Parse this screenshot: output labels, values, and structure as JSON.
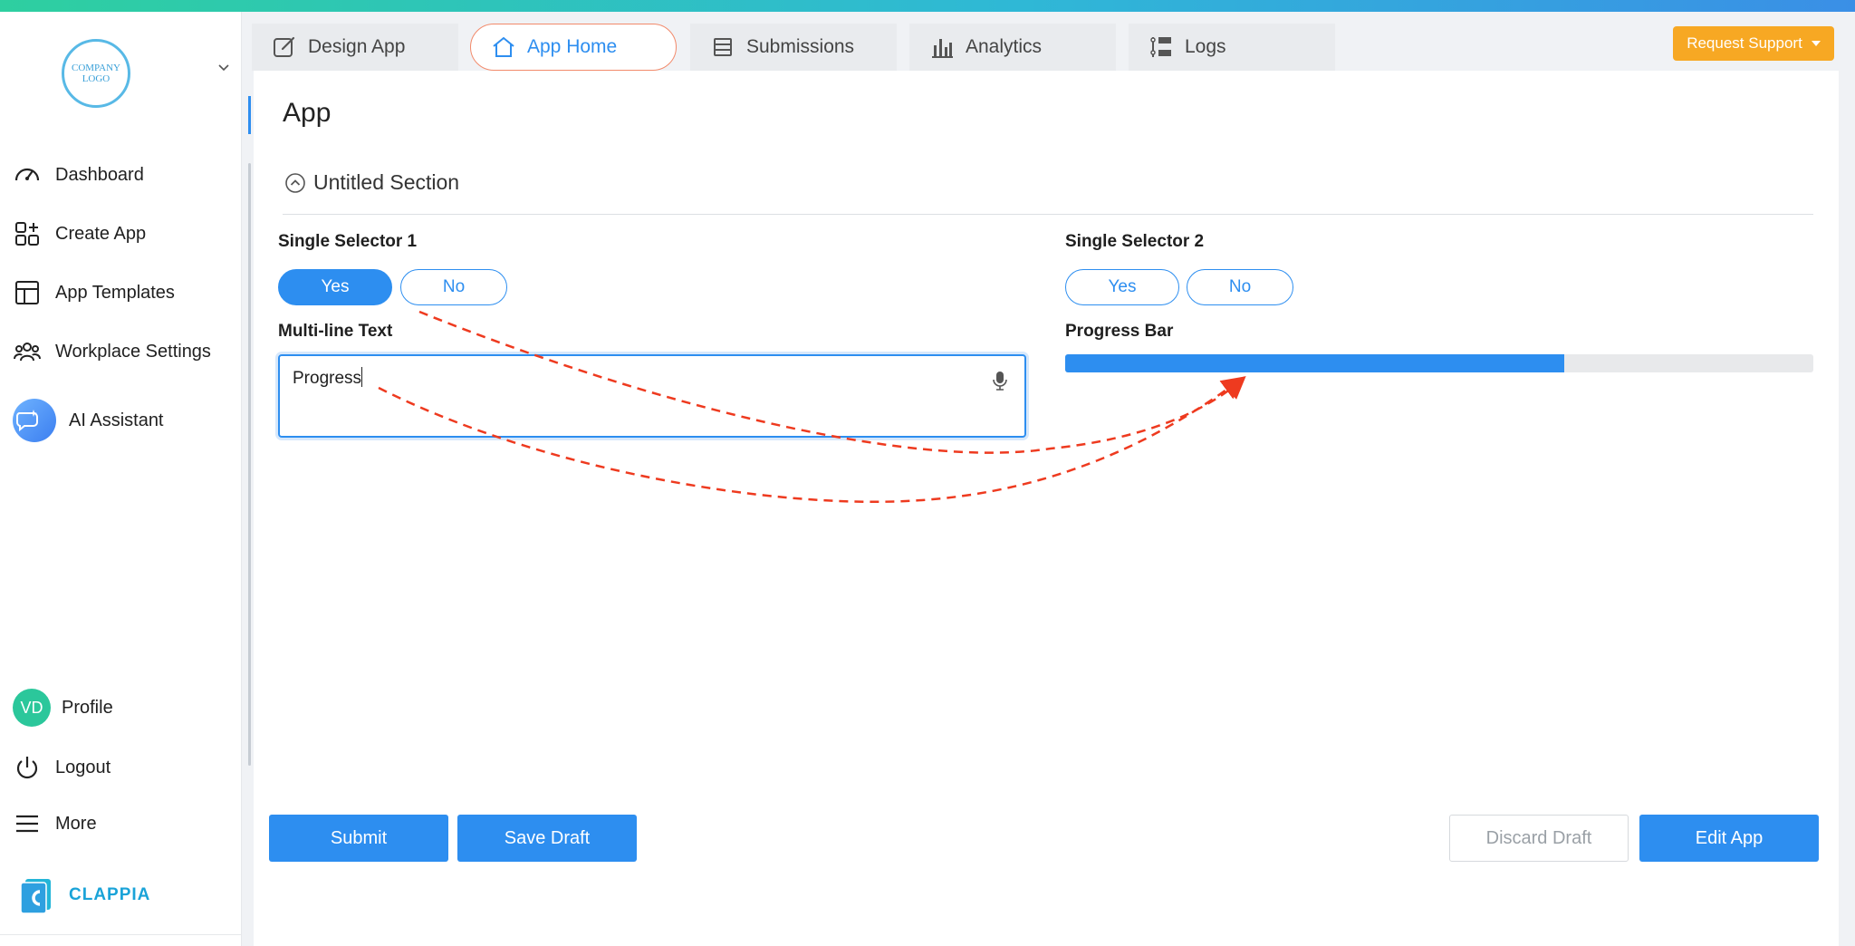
{
  "logo": {
    "text_line1": "COMPANY",
    "text_line2": "LOGO"
  },
  "sidebar": {
    "items": [
      {
        "label": "Dashboard",
        "icon": "speedometer-icon"
      },
      {
        "label": "Create App",
        "icon": "grid-plus-icon"
      },
      {
        "label": "App Templates",
        "icon": "layout-icon"
      },
      {
        "label": "Workplace Settings",
        "icon": "users-icon"
      },
      {
        "label": "AI Assistant",
        "icon": "ai-chat-icon"
      }
    ],
    "profile": {
      "initials": "VD",
      "label": "Profile"
    },
    "logout_label": "Logout",
    "more_label": "More",
    "brand": "CLAPPIA"
  },
  "tabs": [
    {
      "label": "Design App",
      "icon": "edit-icon"
    },
    {
      "label": "App Home",
      "icon": "home-icon",
      "active": true
    },
    {
      "label": "Submissions",
      "icon": "list-icon"
    },
    {
      "label": "Analytics",
      "icon": "bar-chart-icon"
    },
    {
      "label": "Logs",
      "icon": "logs-icon"
    }
  ],
  "support_button": "Request Support",
  "page": {
    "title": "App",
    "section_title": "Untitled Section",
    "selector1": {
      "label": "Single Selector 1",
      "options": [
        "Yes",
        "No"
      ],
      "selected": "Yes"
    },
    "selector2": {
      "label": "Single Selector 2",
      "options": [
        "Yes",
        "No"
      ],
      "selected": ""
    },
    "multiline": {
      "label": "Multi-line Text",
      "value": "Progress"
    },
    "progress": {
      "label": "Progress Bar",
      "fraction": 0.667
    }
  },
  "buttons": {
    "submit": "Submit",
    "save_draft": "Save Draft",
    "discard_draft": "Discard Draft",
    "edit_app": "Edit App"
  },
  "colors": {
    "primary": "#2d8ef0",
    "accent_orange": "#f7a823",
    "annotation_red": "#ee3a1f",
    "avatar": "#2bc79b"
  }
}
